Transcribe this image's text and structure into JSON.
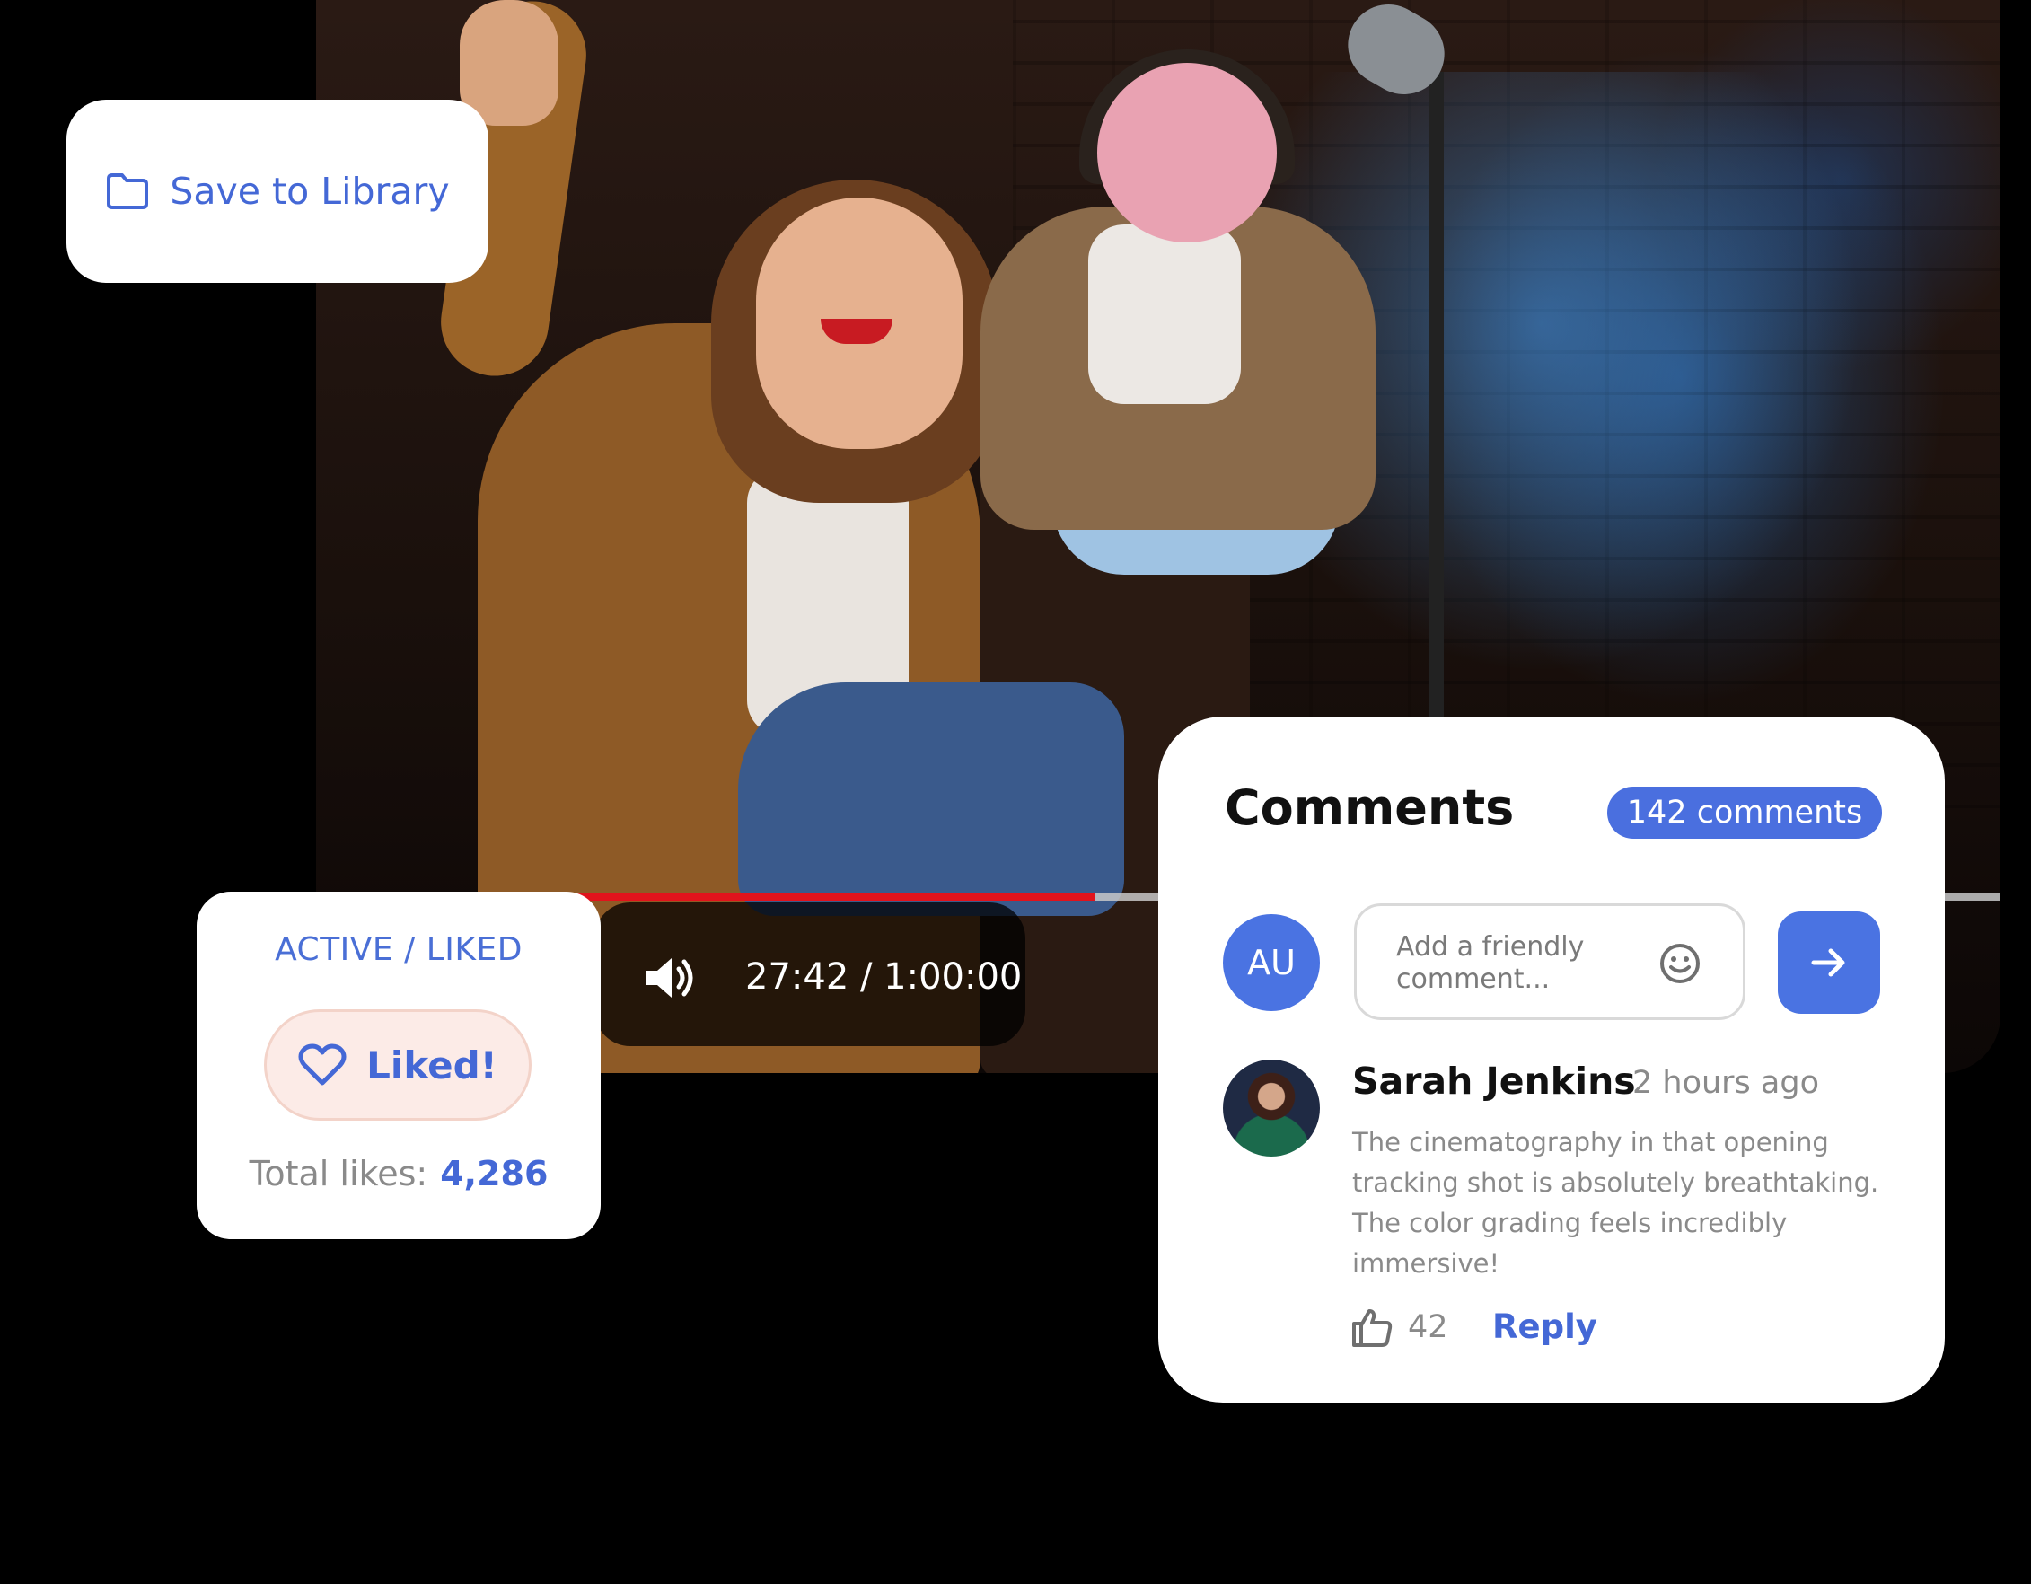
{
  "video": {
    "progress": 0.462,
    "time_text": "27:42 / 1:00:00",
    "volume_icon": "volume-icon"
  },
  "save_card": {
    "icon": "folder-icon",
    "label": "Save to Library"
  },
  "like_card": {
    "status": "ACTIVE / LIKED",
    "button_icon": "heart-icon",
    "button_label": "Liked!",
    "total_label": "Total likes:",
    "total_value": "4,286"
  },
  "comments": {
    "title": "Comments",
    "count_badge": "142 comments",
    "my_avatar_initials": "AU",
    "input_placeholder": "Add a friendly comment...",
    "input_icon": "smile-icon",
    "send_icon": "arrow-right-icon",
    "items": [
      {
        "name": "Sarah Jenkins",
        "time": "2 hours ago",
        "text": "The cinematography in that opening tracking shot is absolutely breathtaking. The color grading feels incredibly immersive!",
        "likes": "42",
        "like_icon": "thumbs-up-icon",
        "reply_label": "Reply"
      }
    ]
  },
  "colors": {
    "accent": "#4468d6",
    "badge_bg": "#4a6fdf",
    "progress_fill": "#e1131c",
    "liked_bg": "#fcebe7"
  }
}
